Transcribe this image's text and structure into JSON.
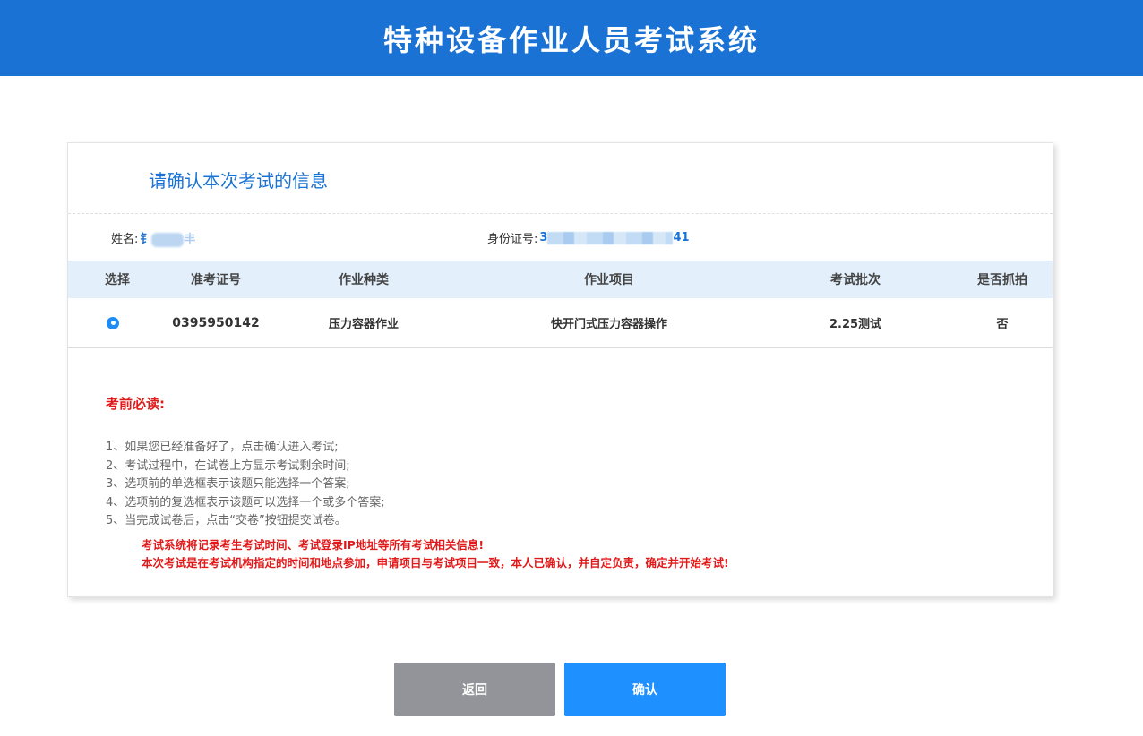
{
  "header": {
    "title": "特种设备作业人员考试系统"
  },
  "card": {
    "title": "请确认本次考试的信息",
    "name_label": "姓名:",
    "name_value_prefix": "钅",
    "name_value_suffix": "丰",
    "id_label": "身份证号:",
    "id_value_prefix": "3",
    "id_value_suffix": "41"
  },
  "table": {
    "headers": [
      "选择",
      "准考证号",
      "作业种类",
      "作业项目",
      "考试批次",
      "是否抓拍"
    ],
    "rows": [
      {
        "selected": true,
        "ticket_no": "0395950142",
        "category": "压力容器作业",
        "project": "快开门式压力容器操作",
        "batch": "2.25测试",
        "capture": "否"
      }
    ]
  },
  "notice": {
    "title": "考前必读:",
    "rules": [
      "1、如果您已经准备好了，点击确认进入考试;",
      "2、考试过程中，在试卷上方显示考试剩余时间;",
      "3、选项前的单选框表示该题只能选择一个答案;",
      "4、选项前的复选框表示该题可以选择一个或多个答案;",
      "5、当完成试卷后，点击“交卷”按钮提交试卷。"
    ],
    "warnings": [
      "考试系统将记录考生考试时间、考试登录IP地址等所有考试相关信息!",
      "本次考试是在考试机构指定的时间和地点参加，申请项目与考试项目一致，本人已确认，并自定负责，确定并开始考试!"
    ]
  },
  "buttons": {
    "back": "返回",
    "confirm": "确认"
  },
  "colors": {
    "primary": "#1a73d4",
    "warning": "#e01a1a",
    "back_button": "#939499",
    "confirm_button": "#1e90ff"
  }
}
